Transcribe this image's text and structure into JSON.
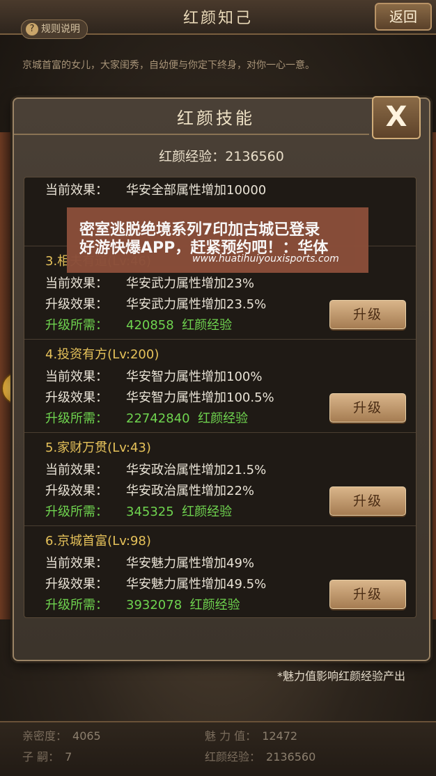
{
  "topbar": {
    "title": "红颜知己",
    "back_label": "返回",
    "rules_label": "规则说明",
    "rules_icon": "?"
  },
  "intro": "京城首富的女儿，大家闺秀，自幼便与你定下终身，对你一心一意。",
  "dialog": {
    "title": "红颜技能",
    "close_label": "X",
    "exp_label": "红颜经验：",
    "exp_value": "2136560",
    "current_label": "当前效果：",
    "next_label": "升级效果：",
    "cost_label": "升级所需：",
    "upgrade_label": "升级",
    "top_effect": "华安全部属性增加10000",
    "skills": [
      {
        "title": "3.相夫有道(Lv:46)",
        "current": "华安武力属性增加23%",
        "next": "华安武力属性增加23.5%",
        "cost": "420858",
        "cost_unit": "红颜经验"
      },
      {
        "title": "4.投资有方(Lv:200)",
        "current": "华安智力属性增加100%",
        "next": "华安智力属性增加100.5%",
        "cost": "22742840",
        "cost_unit": "红颜经验"
      },
      {
        "title": "5.家财万贯(Lv:43)",
        "current": "华安政治属性增加21.5%",
        "next": "华安政治属性增加22%",
        "cost": "345325",
        "cost_unit": "红颜经验"
      },
      {
        "title": "6.京城首富(Lv:98)",
        "current": "华安魅力属性增加49%",
        "next": "华安魅力属性增加49.5%",
        "cost": "3932078",
        "cost_unit": "红颜经验"
      }
    ],
    "footnote": "*魅力值影响红颜经验产出"
  },
  "stats": {
    "intimacy_label": "亲密度：",
    "intimacy": "4065",
    "heirs_label": "子 嗣：",
    "heirs": "7",
    "charm_label": "魅 力 值：",
    "charm": "12472",
    "exp_label": "红颜经验：",
    "exp": "2136560"
  },
  "ad": {
    "line1": "密室逃脱绝境系列7印加古城已登录",
    "line2": "好游快爆APP，赶紧预约吧！：华体",
    "url": "www.huatihuiyouxisports.com"
  }
}
